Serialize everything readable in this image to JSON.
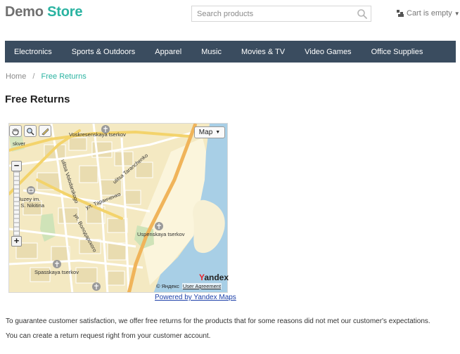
{
  "header": {
    "logo_part1": "Demo",
    "logo_part2": "Store",
    "search_placeholder": "Search products",
    "cart_label": "Cart is empty",
    "icons": [
      "search-icon",
      "cart-icon",
      "caret-down-icon"
    ]
  },
  "nav": {
    "items": [
      "Electronics",
      "Sports & Outdoors",
      "Apparel",
      "Music",
      "Movies & TV",
      "Video Games",
      "Office Supplies"
    ]
  },
  "breadcrumb": {
    "home": "Home",
    "separator": "/",
    "current": "Free Returns"
  },
  "page": {
    "title": "Free Returns"
  },
  "map": {
    "type_button": "Map",
    "provider": "Yandex",
    "copyright": "© Яндекс",
    "user_agreement": "User Agreement",
    "powered_by": "Powered by Yandex Maps",
    "labels": {
      "voskresenskaya": "Voskresenskaya tserkov",
      "skver": "skver",
      "ulitsa_taranchenko": "ulitsa Taranchenko",
      "ulitsa_volodarskogo": "ulitsa Volodarskogo",
      "ul_taranchenko_ru": "ул. Таранченко",
      "ul_volodarskogo_ru": "ул. Володарского",
      "muzey1": "Muzey im.",
      "muzey2": "I. S. Nikitina",
      "uspenskaya": "Uspenskaya tserkov",
      "spasskaya": "Spasskaya tserkov"
    },
    "zoom_in": "+",
    "zoom_out": "−"
  },
  "content": {
    "paragraph1": "To guarantee customer satisfaction, we offer free returns for the products that for some reasons did not met our customer's expectations.",
    "paragraph2": "You can create a return request right from your customer account."
  },
  "colors": {
    "brand_teal": "#2ab3a1",
    "nav_bg": "#3a4c5f",
    "water": "#a8cfe6",
    "land": "#f6ecc4"
  }
}
